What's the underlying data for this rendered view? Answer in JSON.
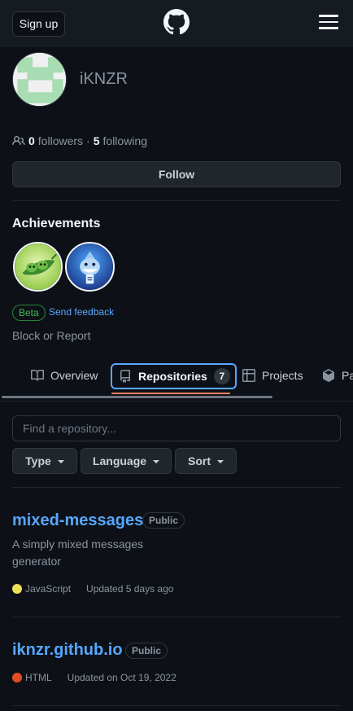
{
  "header": {
    "signup_label": "Sign up",
    "logo_icon": "github-logo-icon",
    "menu_icon": "hamburger-menu-icon"
  },
  "profile": {
    "username": "iKNZR",
    "followers_count": "0",
    "followers_label": "followers",
    "separator": "·",
    "following_count": "5",
    "following_label": "following",
    "follow_label": "Follow"
  },
  "achievements": {
    "title": "Achievements",
    "badges": [
      {
        "icon": "pair-extraordinaire-badge-icon"
      },
      {
        "icon": "shark-badge-icon"
      }
    ],
    "beta_label": "Beta",
    "feedback_label": "Send feedback"
  },
  "block_report_label": "Block or Report",
  "tabs": [
    {
      "label": "Overview",
      "icon": "book-icon"
    },
    {
      "label": "Repositories",
      "icon": "repo-icon",
      "count": "7",
      "active": true
    },
    {
      "label": "Projects",
      "icon": "table-icon"
    },
    {
      "label": "Pa",
      "icon": "package-icon"
    }
  ],
  "search": {
    "placeholder": "Find a repository..."
  },
  "filters": [
    {
      "label": "Type"
    },
    {
      "label": "Language"
    },
    {
      "label": "Sort"
    }
  ],
  "repos": [
    {
      "name": "mixed-messages",
      "visibility": "Public",
      "description": "A simply mixed messages generator",
      "language": "JavaScript",
      "language_color": "#f1e05a",
      "updated": "Updated 5 days ago"
    },
    {
      "name": "iknzr.github.io",
      "visibility": "Public",
      "description": "",
      "language": "HTML",
      "language_color": "#e34c26",
      "updated": "Updated on Oct 19, 2022"
    }
  ],
  "colors": {
    "background": "#0d1117",
    "header": "#161b22",
    "link": "#58a6ff",
    "tab_underline": "#f78166",
    "beta": "#3fb950"
  }
}
